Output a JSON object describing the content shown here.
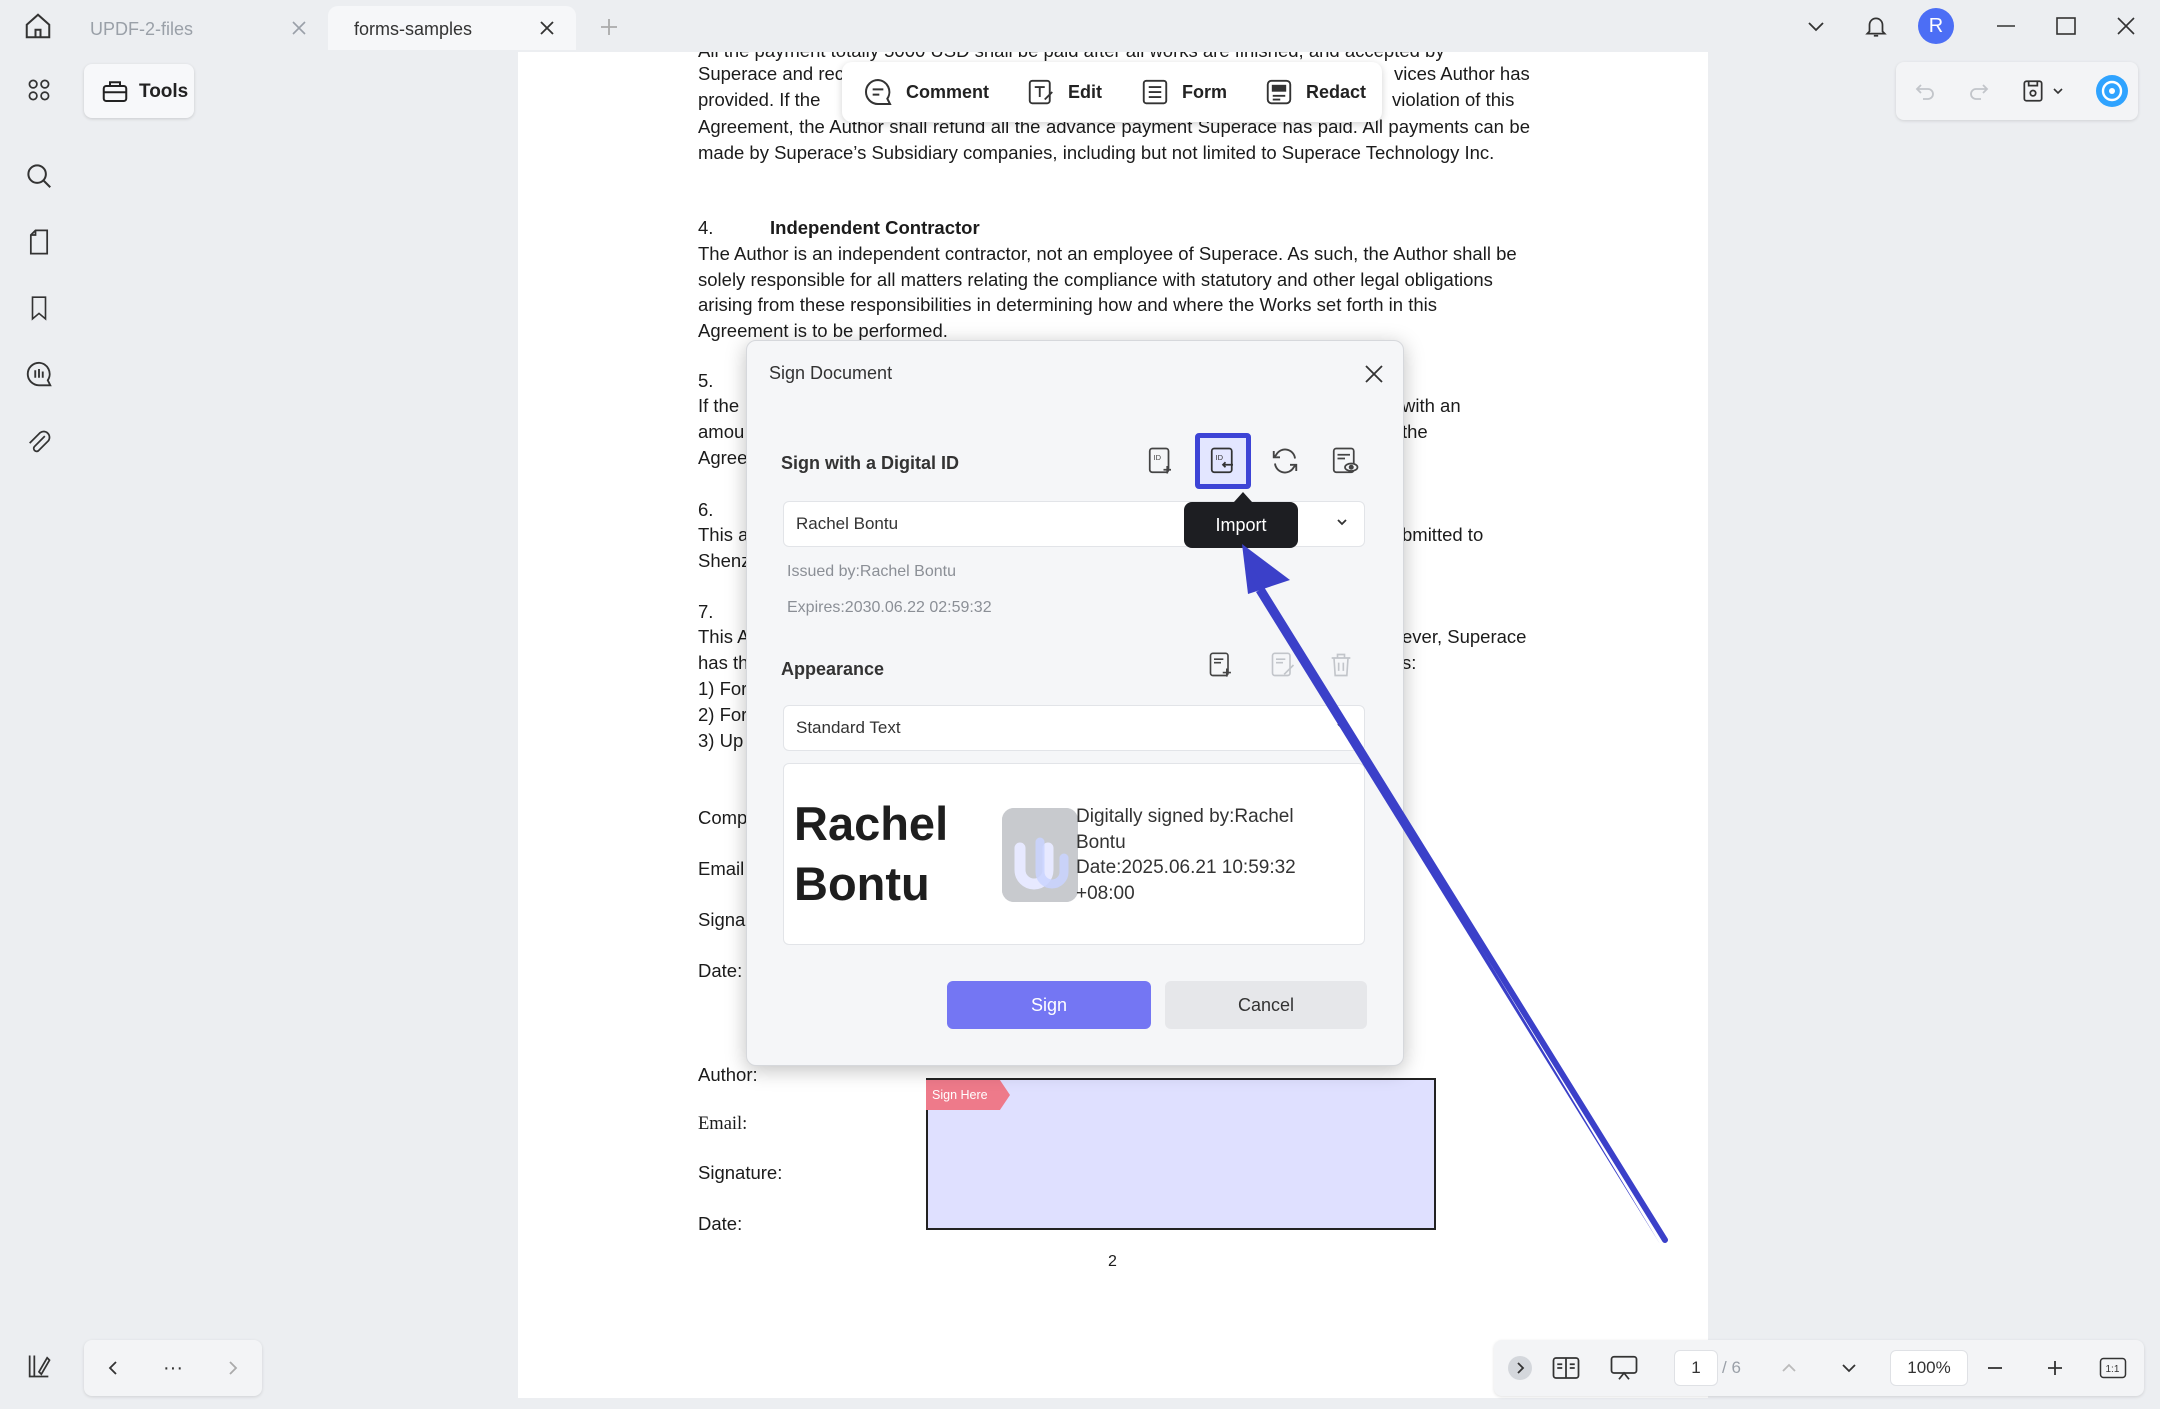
{
  "tabs": [
    {
      "label": "UPDF-2-files"
    },
    {
      "label": "forms-samples"
    }
  ],
  "user": {
    "avatar_letter": "R"
  },
  "tools": {
    "label": "Tools"
  },
  "toolbar": {
    "comment": "Comment",
    "edit": "Edit",
    "form": "Form",
    "redact": "Redact"
  },
  "document": {
    "para3_top": "All the payment totally 5000 USD shall be paid after all works are finished, and accepted by",
    "para3_lines": [
      "Superace and rec",
      "vices Author has",
      "provided. If the",
      "violation of this"
    ],
    "para3_rest": "Agreement, the Author shall refund all the advance payment Superace has paid. All payments can be made by Superace’s Subsidiary companies, including but not limited to Superace Technology Inc.",
    "sec4_num": "4.",
    "sec4_title": "Independent Contractor",
    "sec4_body": "The Author is an independent contractor, not an employee of Superace. As such, the Author shall be solely responsible for all matters relating the compliance with statutory and other legal obligations arising from these responsibilities in determining how and where the Works set forth in this Agreement is to be performed.",
    "sec5_num": "5.",
    "sec5_l1": "If the",
    "sec5_r1": "with an",
    "sec5_l2": "amou",
    "sec5_r2": "the",
    "sec5_l3": "Agree",
    "sec6_num": "6.",
    "sec6_l1": "This a",
    "sec6_r1": "bmitted to",
    "sec6_l2": "Shenz",
    "sec7_num": "7.",
    "sec7_l1": "This A",
    "sec7_r1": "ever, Superace",
    "sec7_l2": "has th",
    "sec7_r2": "s:",
    "sec7_l3": "1) For",
    "sec7_l4": "2) For",
    "sec7_l5": "3)  Up",
    "comp": "Comp",
    "email_a": "Email",
    "signa": "Signa",
    "date_a": "Date:",
    "author": "Author:",
    "email_b": "Email:",
    "signature": "Signature:",
    "date_b": "Date:",
    "page_num": "2",
    "sign_here": "Sign Here"
  },
  "dialog": {
    "title": "Sign Document",
    "digital_id_label": "Sign with a Digital ID",
    "digital_id_value": "Rachel Bontu",
    "issued_by": "Issued by:Rachel Bontu",
    "expires": "Expires:2030.06.22 02:59:32",
    "appearance_label": "Appearance",
    "appearance_value": "Standard Text",
    "preview_name": "Rachel Bontu",
    "preview_info_1": "Digitally signed by:Rachel Bontu",
    "preview_info_2": "Date:2025.06.21 10:59:32 +08:00",
    "sign_button": "Sign",
    "cancel_button": "Cancel",
    "import_tooltip": "Import"
  },
  "bottom_bar": {
    "more": "···",
    "current_page": "1",
    "total_pages": "/ 6",
    "zoom": "100%"
  },
  "colors": {
    "accent": "#7476f3",
    "highlight_border": "#3d44d6",
    "arrow": "#3b40c9",
    "sign_area": "#dfe0ff",
    "sign_here": "#ee7a8a"
  }
}
